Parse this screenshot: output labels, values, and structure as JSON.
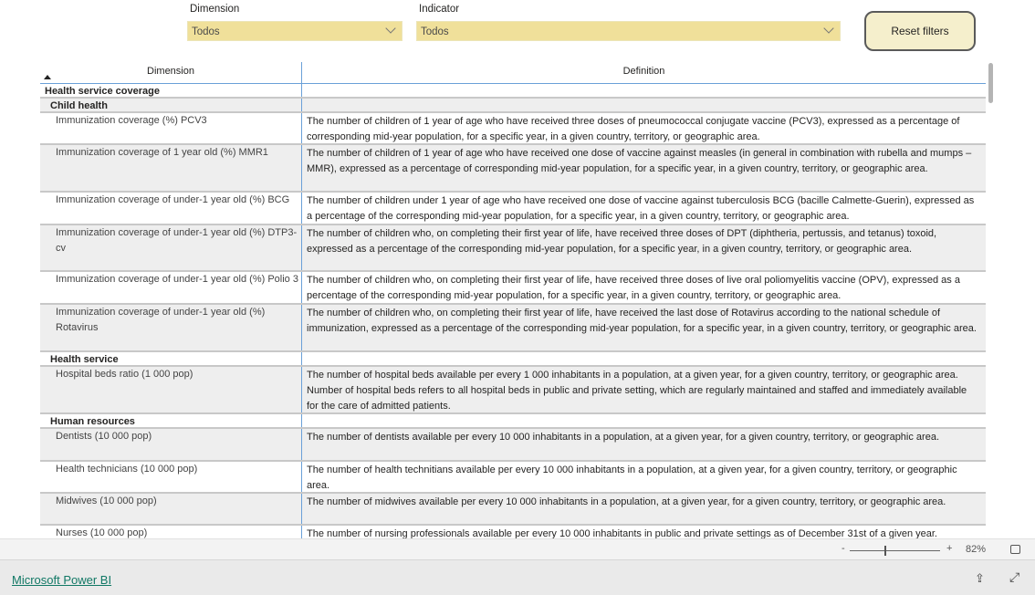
{
  "filters": [
    {
      "label": "Dimension",
      "value": "Todos"
    },
    {
      "label": "Indicator",
      "value": "Todos"
    }
  ],
  "reset_label": "Reset filters",
  "table": {
    "headers": [
      "Dimension",
      "Definition"
    ],
    "rows": [
      {
        "type": "group",
        "dim": "Health service coverage",
        "def": ""
      },
      {
        "type": "sub",
        "dim": "Child health",
        "def": ""
      },
      {
        "type": "item",
        "dim": "Immunization coverage (%) PCV3",
        "def": "The number of children of 1 year of age who have received three doses of pneumococcal conjugate vaccine (PCV3), expressed as a percentage of corresponding mid-year population, for a specific year, in a given country, territory, or geographic area."
      },
      {
        "type": "item",
        "dim": "Immunization coverage of 1 year old (%) MMR1",
        "def": "The number of children of 1 year of age who have received one dose of vaccine against measles (in general in combination with rubella and mumps – MMR), expressed as a percentage of corresponding mid-year population, for a specific year, in a given country, territory, or geographic area."
      },
      {
        "type": "item",
        "dim": "Immunization coverage of under-1 year old (%) BCG",
        "def": "The number of children under 1 year of age who have received one dose of vaccine against tuberculosis BCG (bacille Calmette-Guerin), expressed as a percentage of the corresponding mid-year population, for a specific year, in a given country, territory, or geographic area."
      },
      {
        "type": "item",
        "dim": "Immunization coverage of under-1 year old (%) DTP3-cv",
        "def": "The number of children who, on completing their first year of life, have received three doses of DPT (diphtheria, pertussis, and tetanus) toxoid, expressed as a percentage of the corresponding mid-year population, for a specific year, in a given country, territory, or geographic area."
      },
      {
        "type": "item",
        "dim": "Immunization coverage of under-1 year old (%) Polio 3",
        "def": "The number of children who, on completing their first year of life, have received three doses of live oral poliomyelitis vaccine (OPV), expressed as a percentage of the corresponding mid-year population, for a specific year, in a given country, territory, or geographic area."
      },
      {
        "type": "item",
        "dim": "Immunization coverage of under-1 year old (%) Rotavirus",
        "def": "The number of children who, on completing their first year of life, have received the last dose of Rotavirus according to the national schedule of immunization, expressed as a percentage of the corresponding mid-year population, for a specific year, in a given country, territory, or geographic area."
      },
      {
        "type": "sub",
        "dim": "Health service",
        "def": ""
      },
      {
        "type": "item",
        "dim": "Hospital beds ratio (1 000 pop)",
        "def": "The number of hospital beds available per every 1 000 inhabitants in a population, at a given year, for a given country, territory, or geographic area. Number of hospital beds refers to all hospital beds in public and private setting, which are regularly maintained and staffed and immediately available for the care of admitted patients."
      },
      {
        "type": "sub",
        "dim": "Human resources",
        "def": ""
      },
      {
        "type": "item",
        "dim": "Dentists (10 000 pop)",
        "def": "The number of dentists available per every 10 000 inhabitants in a population, at a given year, for a given country, territory, or geographic area."
      },
      {
        "type": "item",
        "dim": "Health technicians (10 000 pop)",
        "def": "The number of health technitians available per every 10 000 inhabitants in a population, at a given year, for a given country, territory, or geographic area."
      },
      {
        "type": "item",
        "dim": "Midwives (10 000 pop)",
        "def": "The number of midwives available per every 10 000 inhabitants in a population, at a given year, for a given country, territory, or geographic area."
      },
      {
        "type": "item",
        "dim": "Nurses (10 000 pop)",
        "def": "The number of nursing professionals available per every 10 000 inhabitants in public and private settings as of December 31st of a given year."
      }
    ]
  },
  "zoom": {
    "level": "82%",
    "minus": "-",
    "plus": "+",
    "value_percent": 82
  },
  "footer": {
    "link": "Microsoft Power BI"
  }
}
